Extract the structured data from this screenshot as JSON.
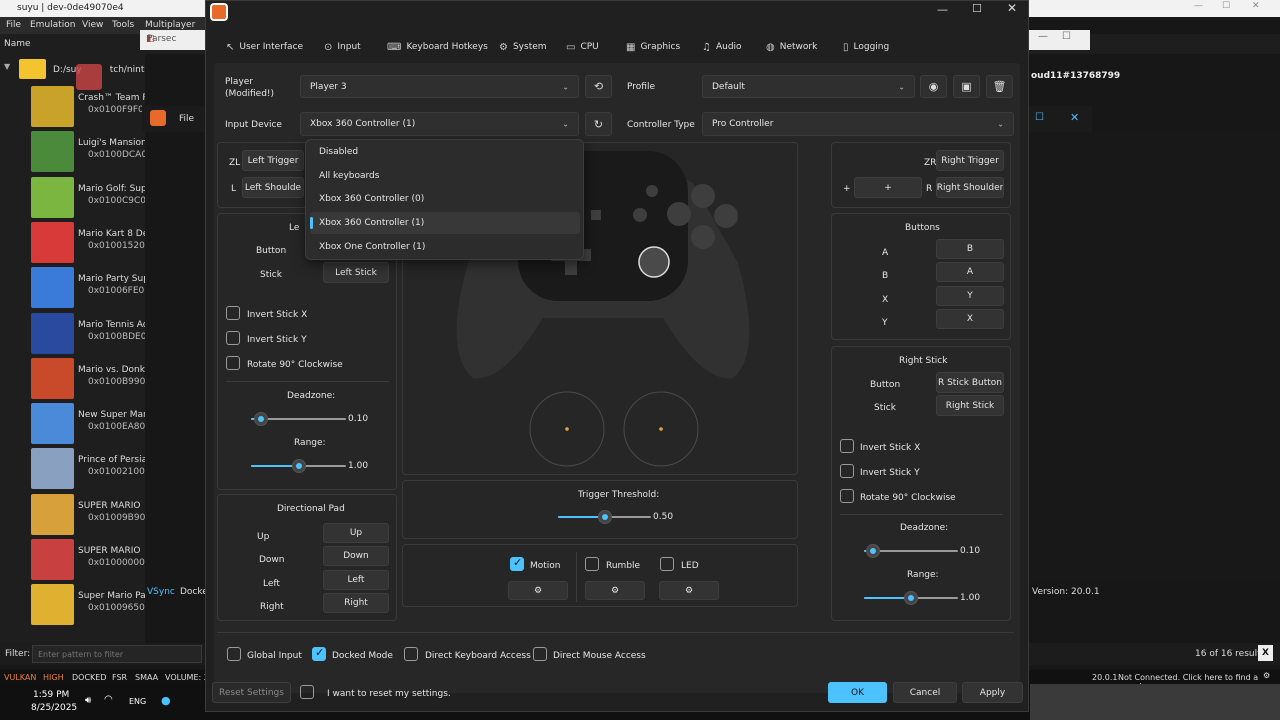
{
  "background_window": {
    "title": "suyu | dev-0de49070e4",
    "menu": [
      "File",
      "Emulation",
      "View",
      "Tools",
      "Multiplayer"
    ],
    "list_header": "Name",
    "folder_path": "D:/suy",
    "folder_path_suffix": "tch/ninter",
    "games": [
      {
        "name": "Crash™ Team R",
        "id": "0x0100F9F00"
      },
      {
        "name": "Luigi's Mansion",
        "id": "0x0100DCA0"
      },
      {
        "name": "Mario Golf: Sup",
        "id": "0x0100C9C0"
      },
      {
        "name": "Mario Kart 8 De",
        "id": "0x01001520"
      },
      {
        "name": "Mario Party Sup",
        "id": "0x01006FE01"
      },
      {
        "name": "Mario Tennis Ac",
        "id": "0x0100BDE0"
      },
      {
        "name": "Mario vs. Donk",
        "id": "0x0100B9901"
      },
      {
        "name": "New Super Mar",
        "id": "0x0100EA800"
      },
      {
        "name": "Prince of Persia",
        "id": "0x01002100"
      },
      {
        "name": "SUPER MARIO",
        "id": "0x01009B900"
      },
      {
        "name": "SUPER MARIO",
        "id": "0x01000000"
      },
      {
        "name": "Super Mario Pa",
        "id": "0x01009650"
      }
    ],
    "filter_label": "Filter:",
    "filter_placeholder": "Enter pattern to filter",
    "results": "16 of 16 results",
    "filter_clear": "X",
    "status_items": [
      "VULKAN",
      "HIGH",
      "DOCKED",
      "FSR",
      "SMAA",
      "VOLUME: 2"
    ],
    "version": "20.0.1",
    "version_right": "Version: 20.0.1",
    "not_connected": "Not Connected. Click here to find a room!",
    "room_id": "oud11#13768799",
    "vsync": "VSync",
    "docked": "Docke",
    "parsec_title": "Parsec",
    "inner_file": "File"
  },
  "taskbar": {
    "time": "1:59 PM",
    "date": "8/25/2025",
    "lang": "ENG"
  },
  "dialog": {
    "tabs": [
      {
        "label": "User Interface",
        "icon": "cursor-icon"
      },
      {
        "label": "Input",
        "icon": "gamepad-icon"
      },
      {
        "label": "Keyboard Hotkeys",
        "icon": "keyboard-icon"
      },
      {
        "label": "System",
        "icon": "gear-icon"
      },
      {
        "label": "CPU",
        "icon": "cpu-icon"
      },
      {
        "label": "Graphics",
        "icon": "image-icon"
      },
      {
        "label": "Audio",
        "icon": "music-icon"
      },
      {
        "label": "Network",
        "icon": "globe-icon"
      },
      {
        "label": "Logging",
        "icon": "document-icon"
      }
    ],
    "player_label": "Player\n(Modified!)",
    "player_value": "Player 3",
    "profile_label": "Profile",
    "profile_value": "Default",
    "input_device_label": "Input Device",
    "input_device_value": "Xbox 360 Controller (1)",
    "controller_type_label": "Controller Type",
    "controller_type_value": "Pro Controller",
    "dropdown_options": [
      "Disabled",
      "All keyboards",
      "Xbox 360 Controller (0)",
      "Xbox 360 Controller (1)",
      "Xbox One Controller (1)"
    ],
    "dropdown_selected_index": 3,
    "left": {
      "zl_label": "ZL",
      "zl_value": "Left Trigger",
      "l_label": "L",
      "l_value": "Left Shoulde",
      "stick_title": "Le",
      "button_label": "Button",
      "stick_label": "Stick",
      "stick_value": "Left Stick",
      "invert_x": "Invert Stick X",
      "invert_y": "Invert Stick Y",
      "rotate": "Rotate 90° Clockwise",
      "deadzone_label": "Deadzone:",
      "deadzone_value": "0.10",
      "deadzone_fraction": 0.1,
      "range_label": "Range:",
      "range_value": "1.00",
      "range_fraction": 0.5
    },
    "dpad": {
      "title": "Directional Pad",
      "rows": [
        {
          "label": "Up",
          "value": "Up"
        },
        {
          "label": "Down",
          "value": "Down"
        },
        {
          "label": "Left",
          "value": "Left"
        },
        {
          "label": "Right",
          "value": "Right"
        }
      ]
    },
    "center": {
      "trigger_label": "Trigger Threshold:",
      "trigger_value": "0.50",
      "trigger_fraction": 0.5,
      "motion": "Motion",
      "motion_checked": true,
      "rumble": "Rumble",
      "rumble_checked": false,
      "led": "LED",
      "led_checked": false
    },
    "right": {
      "zr_label": "ZR",
      "zr_value": "Right Trigger",
      "plus_label": "+",
      "plus_value": "+",
      "r_label": "R",
      "r_value": "Right Shoulder",
      "buttons_title": "Buttons",
      "buttons": [
        {
          "label": "A",
          "value": "B"
        },
        {
          "label": "B",
          "value": "A"
        },
        {
          "label": "X",
          "value": "Y"
        },
        {
          "label": "Y",
          "value": "X"
        }
      ],
      "stick_title": "Right Stick",
      "button_label": "Button",
      "button_value": "R Stick Button",
      "stick_label": "Stick",
      "stick_value": "Right Stick",
      "invert_x": "Invert Stick X",
      "invert_y": "Invert Stick Y",
      "rotate": "Rotate 90° Clockwise",
      "deadzone_label": "Deadzone:",
      "deadzone_value": "0.10",
      "deadzone_fraction": 0.1,
      "range_label": "Range:",
      "range_value": "1.00",
      "range_fraction": 0.5
    },
    "bottom_options": {
      "global_input": "Global Input",
      "global_input_checked": false,
      "docked_mode": "Docked Mode",
      "docked_mode_checked": true,
      "direct_keyboard": "Direct Keyboard Access",
      "direct_keyboard_checked": false,
      "direct_mouse": "Direct Mouse Access",
      "direct_mouse_checked": false
    },
    "footer": {
      "reset": "Reset Settings",
      "confirm": "I want to reset my settings.",
      "ok": "OK",
      "cancel": "Cancel",
      "apply": "Apply"
    },
    "accent_color": "#4cc2ff"
  }
}
